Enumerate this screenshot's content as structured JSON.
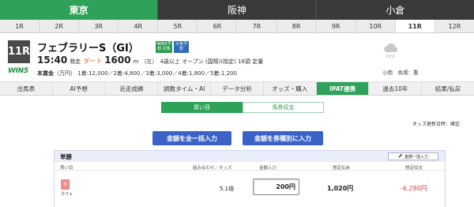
{
  "venues": [
    {
      "label": "東京",
      "active": true
    },
    {
      "label": "阪神",
      "active": false
    },
    {
      "label": "小倉",
      "active": false
    }
  ],
  "races": [
    "1R",
    "2R",
    "3R",
    "4R",
    "5R",
    "6R",
    "7R",
    "8R",
    "9R",
    "10R",
    "11R",
    "12R"
  ],
  "active_race": "11R",
  "race": {
    "number": "11R",
    "win5": "WIN5",
    "name": "フェブラリーS（GⅠ）",
    "badge1": "WIN5予想 対象",
    "badge2": "大荒予想",
    "time": "15:40",
    "time_suffix": "発走",
    "surface": "ダート",
    "distance": "1600",
    "distance_unit": "m",
    "direction": "（左）",
    "conditions": "4歳以上 オープン (国際)(指定) 16頭 定量",
    "prize_label": "本賞金",
    "prize_unit": "（万円）",
    "prizes": "1着:12,000／2着:4,800／3着:3,000／4着:1,800／5着:1,200"
  },
  "weather": {
    "icon": "cloud-rain-icon",
    "text": "小雨　馬場：重"
  },
  "content_tabs": [
    "出馬表",
    "AI予想",
    "近走成績",
    "調教タイム・AI",
    "データ分析",
    "オッズ・購入",
    "IPAT連携",
    "過去10年",
    "結果/払戻"
  ],
  "active_content_tab": "IPAT連携",
  "toggle": {
    "buy": "買い目",
    "history": "馬券収支"
  },
  "odds_updated": "オッズ更新日時：確定",
  "actions": {
    "bulk": "金額を全一括入力",
    "by_type": "金額を券種別に入力"
  },
  "bet_panel": {
    "title": "単勝",
    "bulk_button": "金額一括入力",
    "columns": {
      "picks": "買い目",
      "combo_odds": "組み合わせ／オッズ",
      "amount": "金額入力",
      "payout": "想定払戻",
      "balance": "想定収支"
    },
    "row": {
      "horse_no": "6",
      "horse_name": "カフェ",
      "odds": "5.1倍",
      "amount_value": "200",
      "amount_unit": "円",
      "payout": "1,020円",
      "balance": "-6,280円"
    }
  },
  "colors": {
    "accent_green": "#2fa25a",
    "button_blue": "#3b63c7",
    "loss_red": "#e03a3a",
    "horse_pink": "#f08c8c"
  }
}
